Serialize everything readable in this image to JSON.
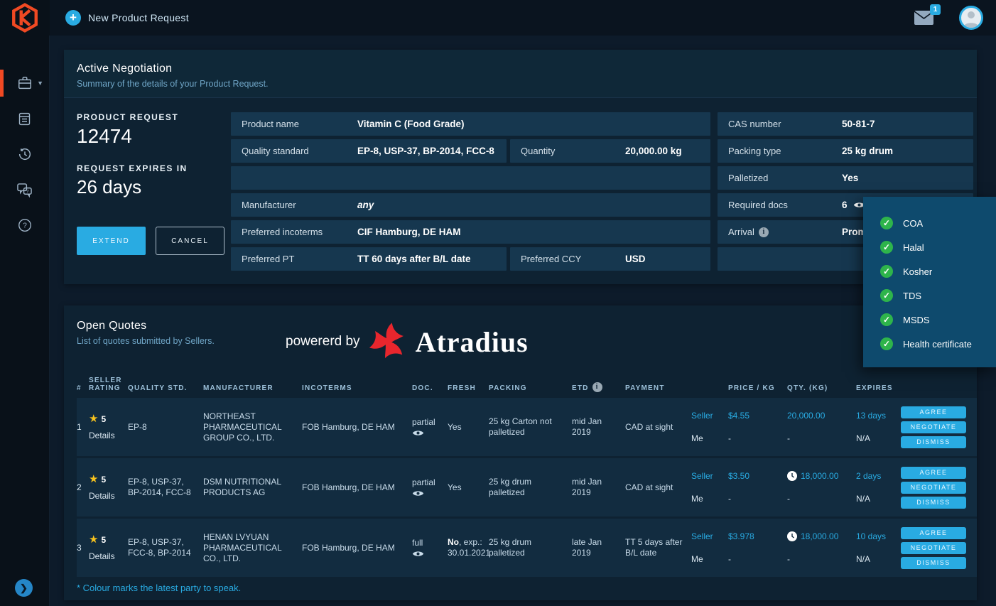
{
  "topbar": {
    "new_request_label": "New Product Request",
    "mail_badge": "1"
  },
  "sidebar": {
    "icons": [
      "briefcase",
      "clipboard",
      "history",
      "chat-question",
      "help"
    ]
  },
  "negotiation": {
    "title": "Active Negotiation",
    "subtitle": "Summary of the details of your Product Request.",
    "request_label": "PRODUCT REQUEST",
    "request_id": "12474",
    "expires_label": "REQUEST EXPIRES IN",
    "expires_value": "26 days",
    "extend_label": "EXTEND",
    "cancel_label": "CANCEL",
    "fields": {
      "product_name": {
        "label": "Product name",
        "value": "Vitamin C (Food Grade)"
      },
      "quality_standard": {
        "label": "Quality standard",
        "value": "EP-8, USP-37, BP-2014, FCC-8"
      },
      "quantity": {
        "label": "Quantity",
        "value": "20,000.00 kg"
      },
      "manufacturer": {
        "label": "Manufacturer",
        "value": "any"
      },
      "preferred_incoterms": {
        "label": "Preferred incoterms",
        "value": "CIF Hamburg, DE HAM"
      },
      "preferred_pt": {
        "label": "Preferred PT",
        "value": "TT 60 days after B/L date"
      },
      "preferred_ccy": {
        "label": "Preferred CCY",
        "value": "USD"
      },
      "cas_number": {
        "label": "CAS number",
        "value": "50-81-7"
      },
      "packing_type": {
        "label": "Packing type",
        "value": "25 kg drum"
      },
      "palletized": {
        "label": "Palletized",
        "value": "Yes"
      },
      "required_docs": {
        "label": "Required docs",
        "value": "6"
      },
      "arrival": {
        "label": "Arrival",
        "value": "Prompt"
      }
    }
  },
  "docs_popup": {
    "items": [
      "COA",
      "Halal",
      "Kosher",
      "TDS",
      "MSDS",
      "Health certificate"
    ]
  },
  "quotes": {
    "title": "Open Quotes",
    "subtitle": "List of quotes submitted by Sellers.",
    "powered_by": "powererd by",
    "brand": "Atradius",
    "footnote": "* Colour marks the latest party to speak.",
    "seller_label": "Seller",
    "me_label": "Me",
    "actions": {
      "agree": "AGREE",
      "negotiate": "NEGOTIATE",
      "dismiss": "DISMISS"
    },
    "columns": {
      "num": "#",
      "rating": "SELLER\nRATING",
      "quality": "QUALITY STD.",
      "manufacturer": "MANUFACTURER",
      "incoterms": "INCOTERMS",
      "doc": "DOC.",
      "fresh": "FRESH",
      "packing": "PACKING",
      "etd": "ETD",
      "payment": "PAYMENT",
      "price": "PRICE / KG",
      "qty": "QTY. (KG)",
      "expires": "EXPIRES"
    },
    "rows": [
      {
        "num": "1",
        "rating": "5",
        "details_label": "Details",
        "quality": "EP-8",
        "manufacturer": "NORTHEAST PHARMACEUTICAL GROUP CO., LTD.",
        "incoterms": "FOB Hamburg, DE HAM",
        "doc": "partial",
        "fresh_bold": "",
        "fresh_rest": "Yes",
        "packing": "25 kg Carton not palletized",
        "etd": "mid Jan 2019",
        "payment": "CAD at sight",
        "seller_price": "$4.55",
        "seller_qty": "20,000.00",
        "seller_expires": "13 days",
        "me_price": "-",
        "me_qty": "-",
        "me_expires": "N/A"
      },
      {
        "num": "2",
        "rating": "5",
        "details_label": "Details",
        "quality": "EP-8, USP-37, BP-2014, FCC-8",
        "manufacturer": "DSM NUTRITIONAL PRODUCTS AG",
        "incoterms": "FOB Hamburg, DE HAM",
        "doc": "partial",
        "fresh_bold": "",
        "fresh_rest": "Yes",
        "packing": "25 kg drum palletized",
        "etd": "mid Jan 2019",
        "payment": "CAD at sight",
        "seller_price": "$3.50",
        "seller_qty": "18,000.00",
        "seller_expires": "2 days",
        "me_price": "-",
        "me_qty": "-",
        "me_expires": "N/A"
      },
      {
        "num": "3",
        "rating": "5",
        "details_label": "Details",
        "quality": "EP-8, USP-37, FCC-8, BP-2014",
        "manufacturer": "HENAN LVYUAN PHARMACEUTICAL CO., LTD.",
        "incoterms": "FOB Hamburg, DE HAM",
        "doc": "full",
        "fresh_bold": "No",
        "fresh_rest": ", exp.: 30.01.2021",
        "packing": "25 kg drum palletized",
        "etd": "late Jan 2019",
        "payment": "TT 5 days after B/L date",
        "seller_price": "$3.978",
        "seller_qty": "18,000.00",
        "seller_expires": "10 days",
        "me_price": "-",
        "me_qty": "-",
        "me_expires": "N/A"
      }
    ]
  }
}
